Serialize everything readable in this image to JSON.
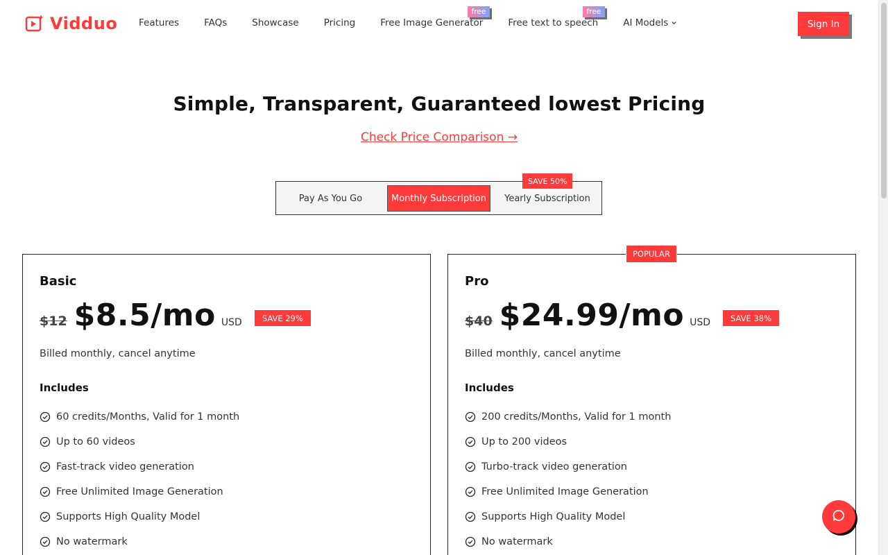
{
  "brand": {
    "name": "Vidduo",
    "accent": "#ff3a3a"
  },
  "nav": {
    "items": [
      {
        "label": "Features"
      },
      {
        "label": "FAQs"
      },
      {
        "label": "Showcase"
      },
      {
        "label": "Pricing"
      },
      {
        "label": "Free Image Generator",
        "badge": "free"
      },
      {
        "label": "Free text to speech",
        "badge": "free"
      },
      {
        "label": "AI Models",
        "icon": "chevron-down-icon"
      }
    ],
    "signin": "Sign In"
  },
  "hero": {
    "title": "Simple, Transparent, Guaranteed lowest Pricing",
    "link": "Check Price Comparison →"
  },
  "toggle": {
    "options": [
      "Pay As You Go",
      "Monthly Subscription",
      "Yearly Subscription"
    ],
    "selected": "Monthly Subscription",
    "yearly_badge": "SAVE 50%"
  },
  "plans": [
    {
      "name": "Basic",
      "old_price": "$12",
      "price": "$8.5/mo",
      "currency": "USD",
      "save": "SAVE 29%",
      "billing": "Billed monthly, cancel anytime",
      "includes_label": "Includes",
      "features": [
        "60 credits/Months, Valid for 1 month",
        "Up to 60 videos",
        "Fast-track video generation",
        "Free Unlimited Image Generation",
        "Supports High Quality Model",
        "No watermark"
      ]
    },
    {
      "name": "Pro",
      "badge": "POPULAR",
      "old_price": "$40",
      "price": "$24.99/mo",
      "currency": "USD",
      "save": "SAVE 38%",
      "billing": "Billed monthly, cancel anytime",
      "includes_label": "Includes",
      "features": [
        "200 credits/Months, Valid for 1 month",
        "Up to 200 videos",
        "Turbo-track video generation",
        "Free Unlimited Image Generation",
        "Supports High Quality Model",
        "No watermark"
      ]
    }
  ],
  "icons": {
    "feature": "check-circle-icon",
    "chat": "chat-bubble-icon"
  }
}
